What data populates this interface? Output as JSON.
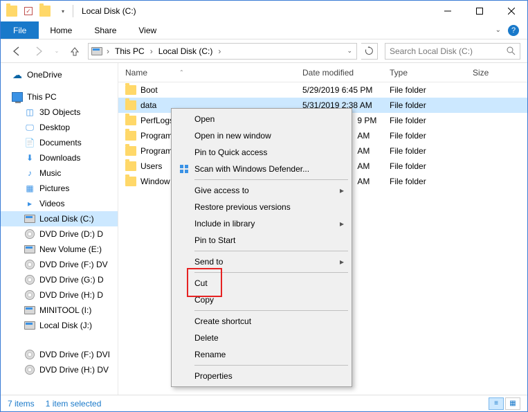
{
  "window": {
    "title": "Local Disk (C:)"
  },
  "ribbon": {
    "file": "File",
    "tabs": [
      "Home",
      "Share",
      "View"
    ]
  },
  "breadcrumb": {
    "root_icon": "drive",
    "items": [
      "This PC",
      "Local Disk (C:)"
    ]
  },
  "search": {
    "placeholder": "Search Local Disk (C:)"
  },
  "nav": {
    "onedrive": "OneDrive",
    "thispc": "This PC",
    "items": [
      {
        "label": "3D Objects",
        "icon": "3d"
      },
      {
        "label": "Desktop",
        "icon": "desktop"
      },
      {
        "label": "Documents",
        "icon": "docs"
      },
      {
        "label": "Downloads",
        "icon": "down"
      },
      {
        "label": "Music",
        "icon": "music"
      },
      {
        "label": "Pictures",
        "icon": "pics"
      },
      {
        "label": "Videos",
        "icon": "video"
      },
      {
        "label": "Local Disk (C:)",
        "icon": "drive",
        "selected": true
      },
      {
        "label": "DVD Drive (D:) D",
        "icon": "dvd"
      },
      {
        "label": "New Volume (E:)",
        "icon": "drive"
      },
      {
        "label": "DVD Drive (F:) DV",
        "icon": "dvd"
      },
      {
        "label": "DVD Drive (G:) D",
        "icon": "dvd"
      },
      {
        "label": "DVD Drive (H:) D",
        "icon": "dvd"
      },
      {
        "label": "MINITOOL (I:)",
        "icon": "drive"
      },
      {
        "label": "Local Disk (J:)",
        "icon": "drive"
      },
      {
        "label": "DVD Drive (F:) DVI",
        "icon": "dvd"
      },
      {
        "label": "DVD Drive (H:) DV",
        "icon": "dvd"
      }
    ],
    "extra_spacer_after": 14
  },
  "columns": {
    "name": "Name",
    "date": "Date modified",
    "type": "Type",
    "size": "Size"
  },
  "rows": [
    {
      "name": "Boot",
      "date": "5/29/2019 6:45 PM",
      "type": "File folder"
    },
    {
      "name": "data",
      "date": "5/31/2019 2:38 AM",
      "type": "File folder",
      "selected": true
    },
    {
      "name": "PerfLogs",
      "date_partial": "9 PM",
      "type": "File folder"
    },
    {
      "name": "Program",
      "date_partial": "AM",
      "type": "File folder"
    },
    {
      "name": "Program",
      "date_partial": "AM",
      "type": "File folder"
    },
    {
      "name": "Users",
      "date_partial": "AM",
      "type": "File folder"
    },
    {
      "name": "Window",
      "date_partial": "AM",
      "type": "File folder"
    }
  ],
  "context_menu": [
    {
      "label": "Open"
    },
    {
      "label": "Open in new window"
    },
    {
      "label": "Pin to Quick access"
    },
    {
      "label": "Scan with Windows Defender...",
      "icon": "defender"
    },
    {
      "sep": true
    },
    {
      "label": "Give access to",
      "sub": true
    },
    {
      "label": "Restore previous versions"
    },
    {
      "label": "Include in library",
      "sub": true
    },
    {
      "label": "Pin to Start"
    },
    {
      "sep": true
    },
    {
      "label": "Send to",
      "sub": true
    },
    {
      "sep": true
    },
    {
      "label": "Cut"
    },
    {
      "label": "Copy"
    },
    {
      "sep": true
    },
    {
      "label": "Create shortcut"
    },
    {
      "label": "Delete"
    },
    {
      "label": "Rename"
    },
    {
      "sep": true
    },
    {
      "label": "Properties"
    }
  ],
  "status": {
    "count": "7 items",
    "sel": "1 item selected"
  }
}
